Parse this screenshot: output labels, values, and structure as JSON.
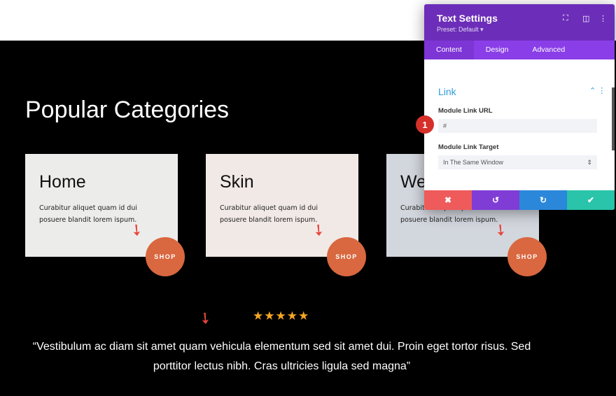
{
  "page": {
    "title": "Popular Categories",
    "cards": [
      {
        "title": "Home",
        "text": "Curabitur aliquet quam id dui posuere blandit lorem ispum.",
        "button": "SHOP"
      },
      {
        "title": "Skin",
        "text": "Curabitur aliquet quam id dui posuere blandit lorem ispum.",
        "button": "SHOP"
      },
      {
        "title": "We",
        "text": "Curabitur aliquet quam id dui posuere blandit lorem ispum.",
        "button": "SHOP"
      }
    ],
    "rating": "★★★★★",
    "rating_value": 5,
    "quote": "“Vestibulum ac diam sit amet quam vehicula elementum sed sit amet dui. Proin eget tortor risus. Sed porttitor lectus nibh. Cras ultricies ligula sed magna”"
  },
  "panel": {
    "title": "Text Settings",
    "preset": "Preset: Default ▾",
    "tabs": [
      "Content",
      "Design",
      "Advanced"
    ],
    "section": "Link",
    "url_label": "Module Link URL",
    "url_value": "#",
    "target_label": "Module Link Target",
    "target_value": "In The Same Window",
    "badge": "1"
  },
  "colors": {
    "accent": "#d9673f",
    "panel_header": "#6c2eb9",
    "cancel": "#ef5a5a",
    "undo": "#7f3dd6",
    "redo": "#2b87da",
    "save": "#29c4a9"
  }
}
